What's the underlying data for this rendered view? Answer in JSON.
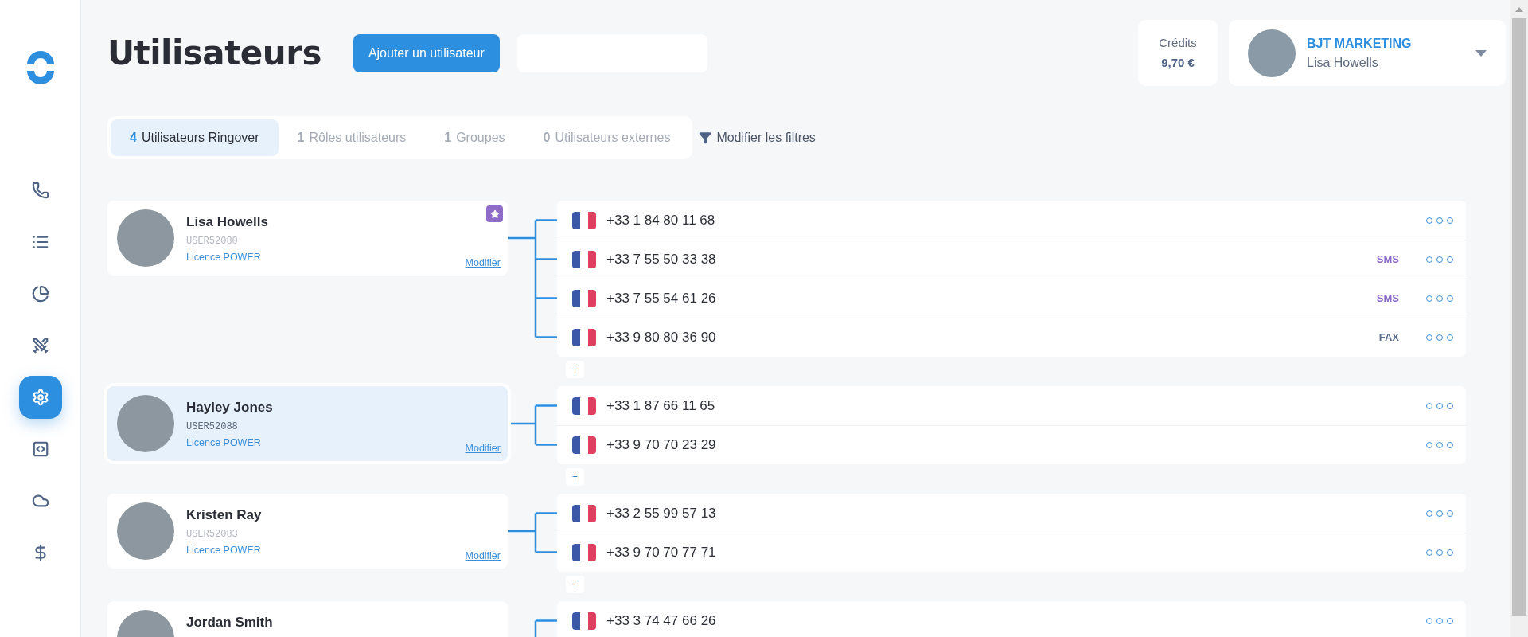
{
  "sidebar": {
    "items": [
      {
        "kind": "phone",
        "selected": false
      },
      {
        "kind": "list",
        "selected": false
      },
      {
        "kind": "chart",
        "selected": false
      },
      {
        "kind": "swords",
        "selected": false
      },
      {
        "kind": "settings",
        "selected": true
      },
      {
        "kind": "code",
        "selected": false
      },
      {
        "kind": "cloud",
        "selected": false
      },
      {
        "kind": "dollar",
        "selected": false
      }
    ]
  },
  "header": {
    "title": "Utilisateurs",
    "add_button": "Ajouter un utilisateur",
    "credits": {
      "label": "Crédits",
      "value": "9,70 €"
    },
    "account": {
      "company": "BJT MARKETING",
      "user": "Lisa Howells"
    }
  },
  "tabs": [
    {
      "count": "4",
      "label": "Utilisateurs Ringover",
      "selected": true
    },
    {
      "count": "1",
      "label": "Rôles utilisateurs",
      "selected": false
    },
    {
      "count": "1",
      "label": "Groupes",
      "selected": false
    },
    {
      "count": "0",
      "label": "Utilisateurs externes",
      "selected": false
    }
  ],
  "filter_link": "Modifier les filtres",
  "users": [
    {
      "name": "Lisa Howells",
      "id": "USER52080",
      "licence": "Licence POWER",
      "edit": "Modifier",
      "starred": true,
      "highlighted": false,
      "add_label": "+",
      "numbers": [
        {
          "number": "+33 1 84 80 11 68"
        },
        {
          "number": "+33 7 55 50 33 38",
          "tag": {
            "text": "SMS",
            "kind": "sms"
          }
        },
        {
          "number": "+33 7 55 54 61 26",
          "tag": {
            "text": "SMS",
            "kind": "sms"
          }
        },
        {
          "number": "+33 9 80 80 36 90",
          "tag": {
            "text": "FAX",
            "kind": "fax"
          }
        }
      ]
    },
    {
      "name": "Hayley Jones",
      "id": "USER52088",
      "licence": "Licence POWER",
      "edit": "Modifier",
      "starred": false,
      "highlighted": true,
      "add_label": "+",
      "numbers": [
        {
          "number": "+33 1 87 66 11 65"
        },
        {
          "number": "+33 9 70 70 23 29"
        }
      ]
    },
    {
      "name": "Kristen Ray",
      "id": "USER52083",
      "licence": "Licence POWER",
      "edit": "Modifier",
      "starred": false,
      "highlighted": false,
      "add_label": "+",
      "numbers": [
        {
          "number": "+33 2 55 99 57 13"
        },
        {
          "number": "+33 9 70 70 77 71"
        }
      ]
    },
    {
      "name": "Jordan Smith",
      "starred": false,
      "highlighted": false,
      "numbers": [
        {
          "number": "+33 3 74 47 66 26"
        }
      ]
    }
  ]
}
